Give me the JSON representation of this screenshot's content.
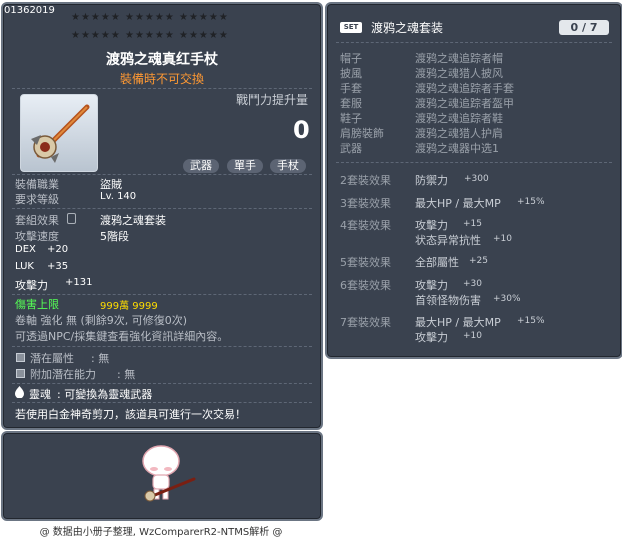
{
  "item": {
    "id": "01362019",
    "title": "渡鸦之魂真红手杖",
    "subtitle": "裝備時不可交換",
    "power_label": "戰鬥力提升量",
    "power_value": "0",
    "tags": [
      "武器",
      "單手",
      "手杖"
    ],
    "job_label": "裝備職業",
    "job_value": "盜賊",
    "level_label": "要求等級",
    "level_value": "Lv. 140",
    "set_label": "套組效果",
    "set_value": "渡鸦之魂套装",
    "speed_label": "攻擊速度",
    "speed_value": "5階段",
    "stats": [
      {
        "name": "DEX",
        "value": "+20"
      },
      {
        "name": "LUK",
        "value": "+35"
      },
      {
        "name": "攻擊力",
        "value": "+131"
      }
    ],
    "damage_cap_label": "傷害上限",
    "damage_cap_value": "999萬 9999",
    "scroll_line": "卷軸 強化 無 (剩餘9次, 可修復0次)",
    "npc_line": "可透過NPC/採集鍵查看強化資訊詳細內容。",
    "potential_label": "潛在屬性",
    "potential_value": ": 無",
    "bonus_label": "附加潛在能力",
    "bonus_value": ": 無",
    "soul_label": "靈魂",
    "soul_value": ": 可變換為靈魂武器",
    "scissor_line": "若使用白金神奇剪刀，該道具可進行一次交易！"
  },
  "set": {
    "badge": "SET",
    "title": "渡鸦之魂套装",
    "count": "0 / 7",
    "pieces": [
      {
        "slot": "帽子",
        "name": "渡鸦之魂追踪者帽"
      },
      {
        "slot": "披風",
        "name": "渡鸦之魂猎人披风"
      },
      {
        "slot": "手套",
        "name": "渡鸦之魂追踪者手套"
      },
      {
        "slot": "套服",
        "name": "渡鸦之魂追踪者盔甲"
      },
      {
        "slot": "鞋子",
        "name": "渡鸦之魂追踪者鞋"
      },
      {
        "slot": "肩膀裝飾",
        "name": "渡鸦之魂猎人护肩"
      },
      {
        "slot": "武器",
        "name": "渡鸦之魂器中选1"
      }
    ],
    "effects": [
      {
        "label": "2套裝效果",
        "lines": [
          [
            "防禦力",
            "+300"
          ]
        ]
      },
      {
        "label": "3套裝效果",
        "lines": [
          [
            "最大HP / 最大MP",
            "+15%"
          ]
        ]
      },
      {
        "label": "4套裝效果",
        "lines": [
          [
            "攻擊力",
            "+15"
          ],
          [
            "状态异常抗性",
            "+10"
          ]
        ]
      },
      {
        "label": "5套裝效果",
        "lines": [
          [
            "全部屬性",
            "+25"
          ]
        ]
      },
      {
        "label": "6套裝效果",
        "lines": [
          [
            "攻擊力",
            "+30"
          ],
          [
            "首领怪物伤害",
            "+30%"
          ]
        ]
      },
      {
        "label": "7套裝效果",
        "lines": [
          [
            "最大HP / 最大MP",
            "+15%"
          ],
          [
            "攻擊力",
            "+10"
          ]
        ]
      }
    ]
  },
  "footer": "@ 数据由小册子整理, WzComparerR2-NTMS解析 @",
  "icons": [
    "staff-icon",
    "character-icon",
    "soul-icon",
    "lock-icon"
  ]
}
